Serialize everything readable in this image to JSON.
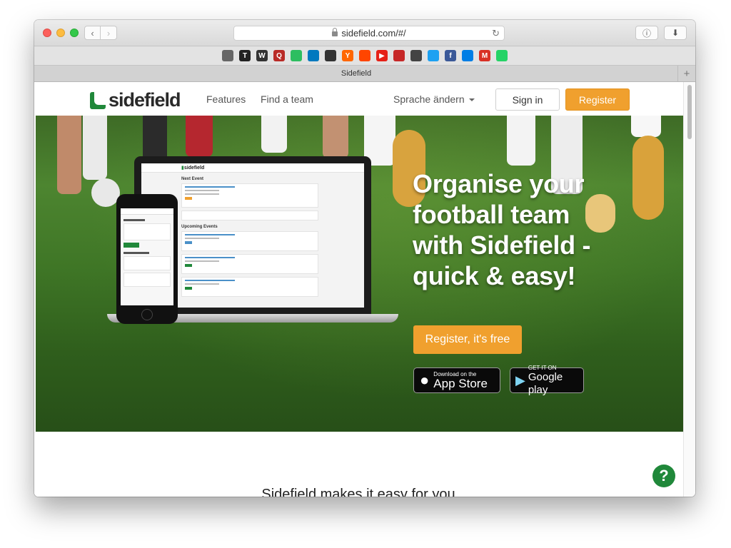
{
  "browser": {
    "url": "sidefield.com/#/",
    "tab_title": "Sidefield",
    "new_tab": "+",
    "bookmarks": [
      {
        "name": "apple-icon",
        "glyph": "",
        "color": "#666666"
      },
      {
        "name": "nytimes-icon",
        "glyph": "T",
        "color": "#222222"
      },
      {
        "name": "wikipedia-icon",
        "glyph": "W",
        "color": "#333333"
      },
      {
        "name": "quora-icon",
        "glyph": "Q",
        "color": "#b92b27"
      },
      {
        "name": "evernote-icon",
        "glyph": "",
        "color": "#2dbe60"
      },
      {
        "name": "trello-icon",
        "glyph": "",
        "color": "#0079bf"
      },
      {
        "name": "github-icon",
        "glyph": "",
        "color": "#333333"
      },
      {
        "name": "hackernews-icon",
        "glyph": "Y",
        "color": "#ff6600"
      },
      {
        "name": "reddit-icon",
        "glyph": "",
        "color": "#ff4500"
      },
      {
        "name": "youtube-icon",
        "glyph": "▶",
        "color": "#e62117"
      },
      {
        "name": "bookmark-red-icon",
        "glyph": "",
        "color": "#c62828"
      },
      {
        "name": "qrcode-icon",
        "glyph": "",
        "color": "#444444"
      },
      {
        "name": "twitter-icon",
        "glyph": "",
        "color": "#1da1f2"
      },
      {
        "name": "facebook-icon",
        "glyph": "f",
        "color": "#3b5998"
      },
      {
        "name": "dropbox-icon",
        "glyph": "",
        "color": "#007ee5"
      },
      {
        "name": "gmail-icon",
        "glyph": "M",
        "color": "#d93025"
      },
      {
        "name": "whatsapp-icon",
        "glyph": "",
        "color": "#25d366"
      }
    ]
  },
  "nav": {
    "logo": "sidefield",
    "features": "Features",
    "find_team": "Find a team",
    "language": "Sprache ändern",
    "sign_in": "Sign in",
    "register": "Register"
  },
  "hero": {
    "title": "Organise your football team with Sidefield - quick & easy!",
    "cta": "Register, it's free",
    "app_store_small": "Download on the",
    "app_store_big": "App Store",
    "google_small": "GET IT ON",
    "google_big": "Google play",
    "mockup": {
      "logo": "sidefield",
      "next_event": "Next Event",
      "upcoming": "Upcoming Events"
    }
  },
  "content": {
    "tagline": "Sidefield makes it easy for you"
  },
  "help": {
    "label": "?"
  },
  "colors": {
    "brand_green": "#20883a",
    "accent_orange": "#f0a02e"
  }
}
